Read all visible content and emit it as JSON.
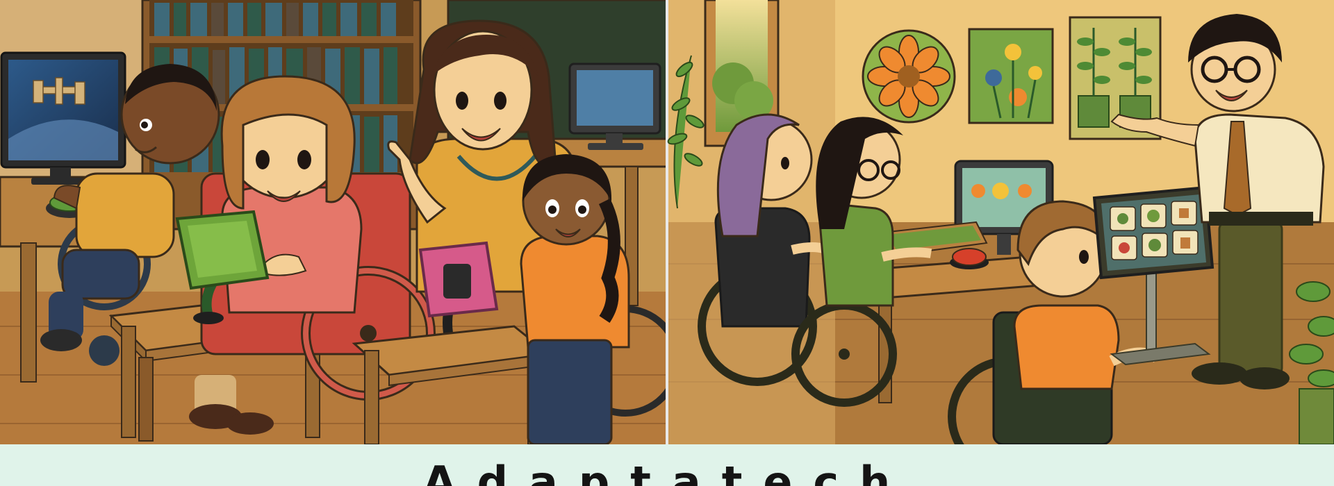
{
  "caption": {
    "title": "Adaptatech"
  },
  "scene": {
    "left_panel": "classroom-assistive-technology",
    "right_panel": "garden-themed-classroom-communication-devices"
  },
  "palette": {
    "wall_left": "#c79a55",
    "wall_right": "#eec77c",
    "floor": "#b57a3c",
    "table": "#b98240",
    "outline": "#3a2a1a",
    "banner_bg": "#e0f3ea",
    "banner_text": "#141414"
  }
}
